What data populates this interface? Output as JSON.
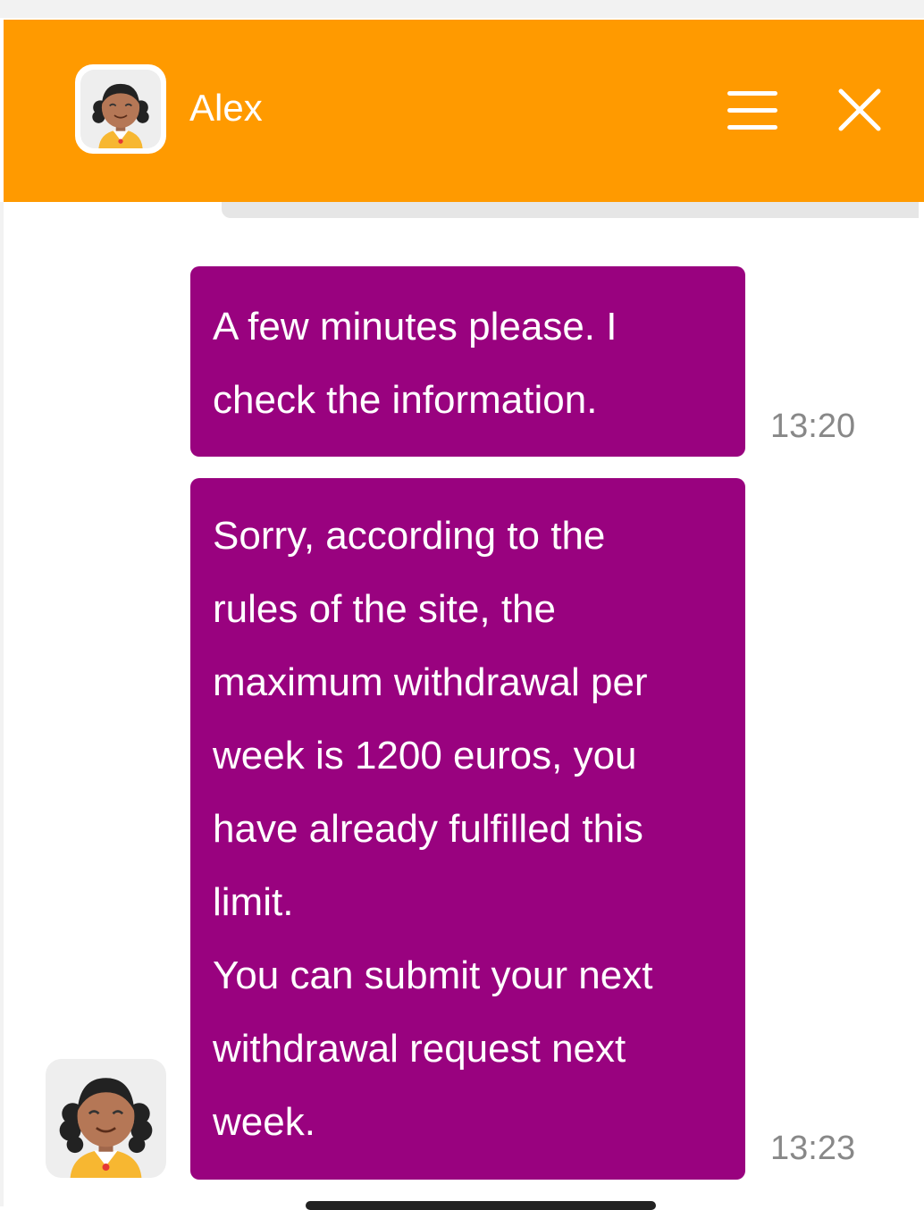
{
  "header": {
    "agent_name": "Alex",
    "background_color": "#ff9a00",
    "menu_icon": "hamburger-menu-icon",
    "close_icon": "close-icon"
  },
  "messages": [
    {
      "sender": "agent",
      "text": "A few minutes please. I\ncheck the information.",
      "time": "13:20"
    },
    {
      "sender": "agent",
      "text": "Sorry, according to the\nrules of the site, the\nmaximum withdrawal per\nweek is 1200 euros, you\nhave already fulfilled this\nlimit.\nYou can submit your next\nwithdrawal request next\nweek.",
      "time": "13:23"
    }
  ],
  "colors": {
    "bubble": "#99027f",
    "timestamp": "#888888"
  }
}
